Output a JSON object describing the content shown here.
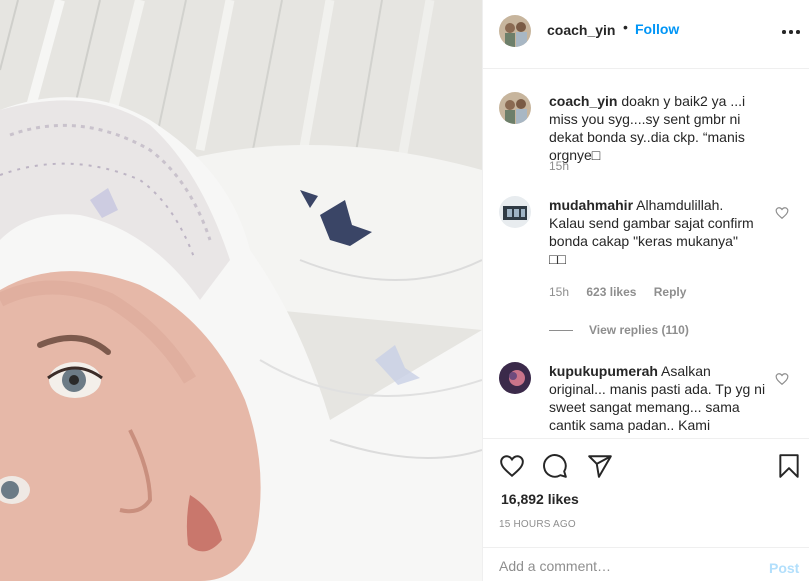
{
  "post": {
    "photo_icon": "selfie-photo"
  },
  "header": {
    "username": "coach_yin",
    "separator": "•",
    "follow_label": "Follow",
    "more_icon": "more-options-icon"
  },
  "comments": [
    {
      "username": "coach_yin",
      "text": "doakn y baik2 ya ...i miss you syg....sy sent gmbr ni dekat bonda sy..dia ckp. “manis orgnye□",
      "time": "15h"
    },
    {
      "username": "mudahmahir",
      "text": "Alhamdulillah.\nKalau send gambar sajat confirm bonda cakap \"keras mukanya\"\n□□",
      "time": "15h",
      "likes": "623 likes",
      "reply_label": "Reply",
      "view_replies": "View replies (110)"
    },
    {
      "username": "kupukupumerah",
      "text": "Asalkan original... manis pasti ada. Tp yg ni sweet sangat memang... sama cantik sama padan.. Kami"
    }
  ],
  "actions": {
    "like_icon": "heart-icon",
    "comment_icon": "comment-icon",
    "share_icon": "share-icon",
    "save_icon": "bookmark-icon",
    "likes_count": "16,892 likes",
    "timestamp": "15 HOURS AGO"
  },
  "add_comment": {
    "placeholder": "Add a comment…",
    "post_label": "Post"
  },
  "colors": {
    "accent": "#0095f6",
    "post_disabled": "#b2dffc",
    "secondary_text": "#8e8e8e",
    "primary_text": "#262626",
    "divider": "#efefef"
  }
}
